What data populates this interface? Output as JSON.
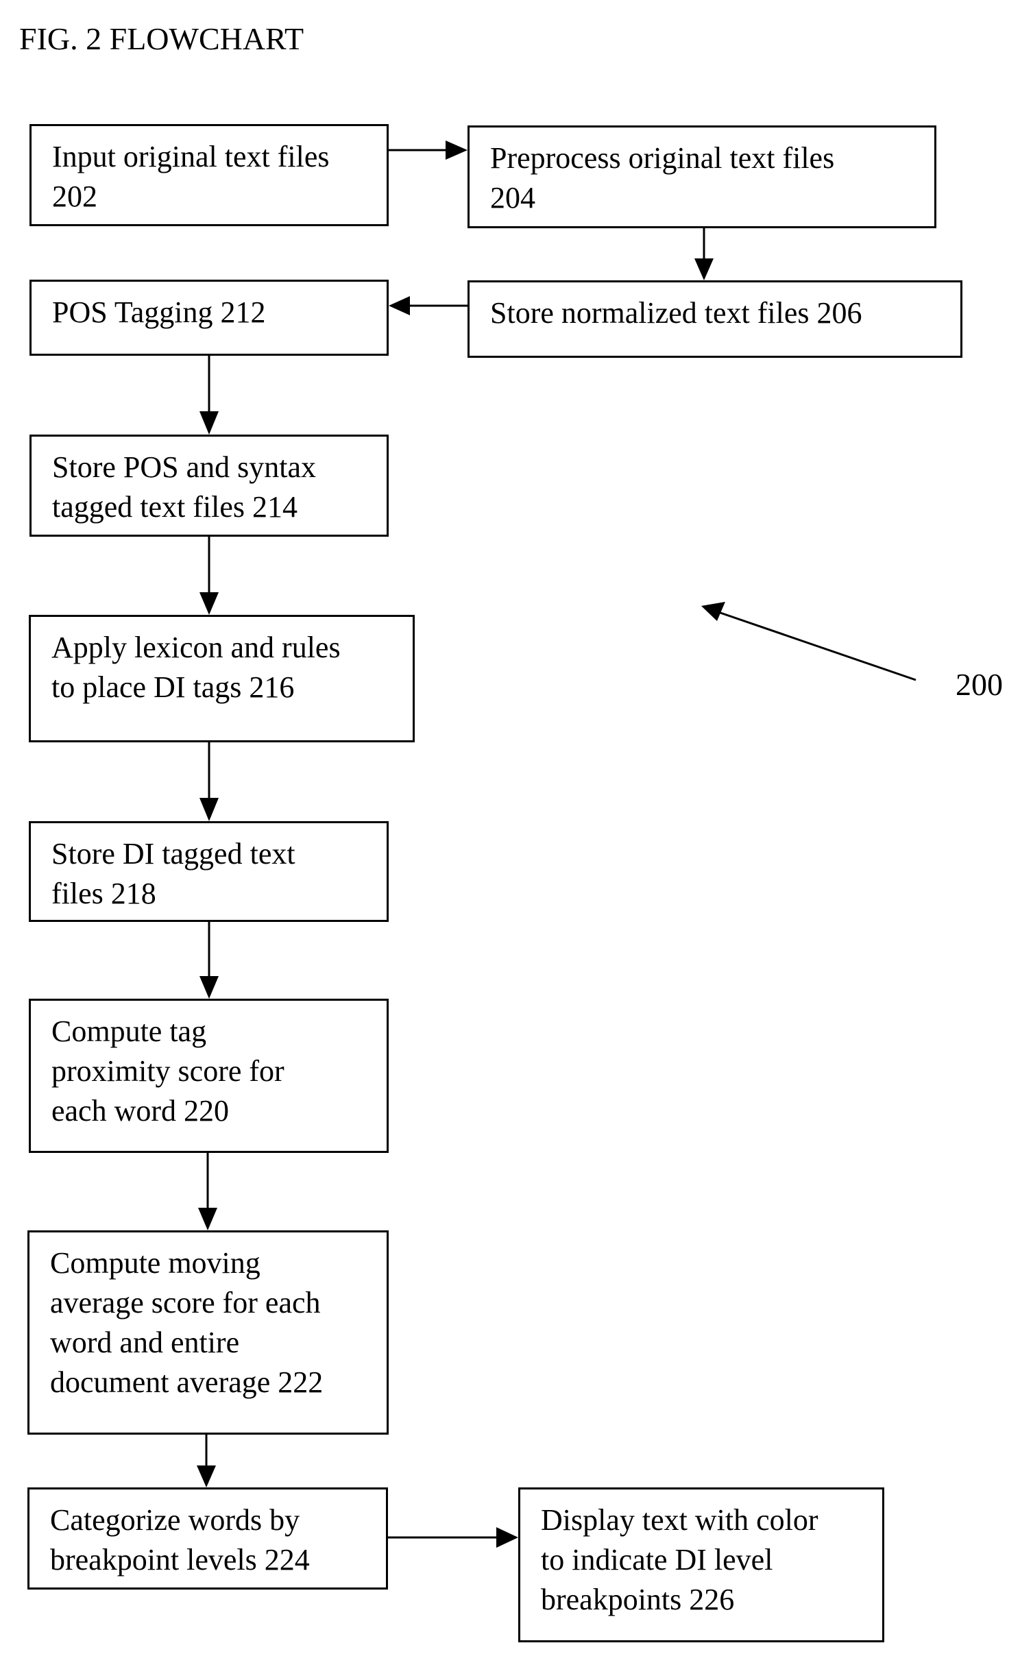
{
  "figure": {
    "title": "FIG. 2 FLOWCHART",
    "reference_label": "200"
  },
  "steps": [
    {
      "id": "202",
      "text": "Input original text files\n202"
    },
    {
      "id": "204",
      "text": "Preprocess original text files\n204"
    },
    {
      "id": "206",
      "text": "Store normalized text files 206"
    },
    {
      "id": "212",
      "text": "POS Tagging 212"
    },
    {
      "id": "214",
      "text": "Store POS and syntax\ntagged text files 214"
    },
    {
      "id": "216",
      "text": "Apply lexicon and rules\nto place DI tags 216"
    },
    {
      "id": "218",
      "text": "Store DI tagged text\nfiles 218"
    },
    {
      "id": "220",
      "text": "Compute tag\nproximity score for\neach word 220"
    },
    {
      "id": "222",
      "text": "Compute moving\naverage score for each\nword and entire\ndocument average 222"
    },
    {
      "id": "224",
      "text": "Categorize words by\nbreakpoint levels 224"
    },
    {
      "id": "226",
      "text": "Display text with color\nto indicate DI level\nbreakpoints 226"
    }
  ],
  "connections": [
    {
      "from": "202",
      "to": "204"
    },
    {
      "from": "204",
      "to": "206"
    },
    {
      "from": "206",
      "to": "212"
    },
    {
      "from": "212",
      "to": "214"
    },
    {
      "from": "214",
      "to": "216"
    },
    {
      "from": "216",
      "to": "218"
    },
    {
      "from": "218",
      "to": "220"
    },
    {
      "from": "220",
      "to": "222"
    },
    {
      "from": "222",
      "to": "224"
    },
    {
      "from": "224",
      "to": "226"
    }
  ]
}
